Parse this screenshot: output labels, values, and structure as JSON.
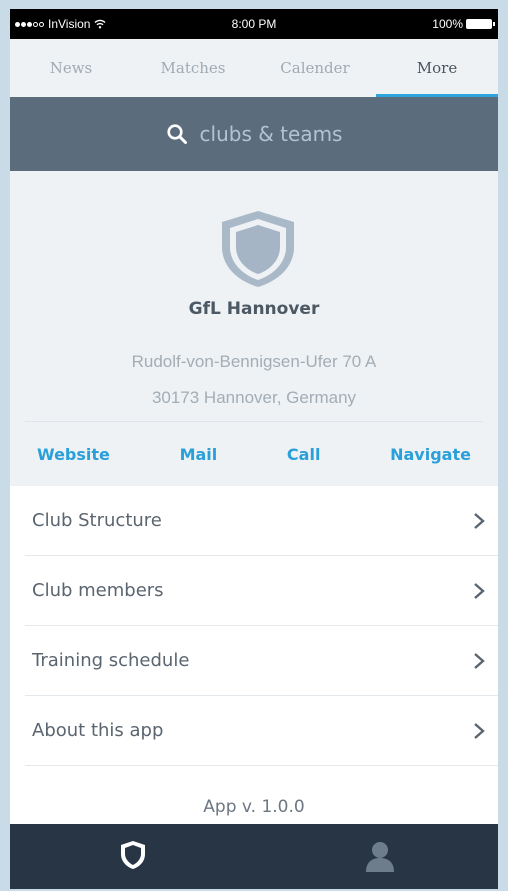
{
  "status_bar": {
    "carrier": "InVision",
    "time": "8:00 PM",
    "battery": "100%"
  },
  "tabs": [
    {
      "label": "News",
      "active": false
    },
    {
      "label": "Matches",
      "active": false
    },
    {
      "label": "Calender",
      "active": false
    },
    {
      "label": "More",
      "active": true
    }
  ],
  "search": {
    "placeholder": "clubs & teams",
    "icon": "search-icon"
  },
  "club": {
    "name": "GfL Hannover",
    "address_line1": "Rudolf-von-Bennigsen-Ufer 70 A",
    "address_line2": "30173 Hannover, Germany",
    "crest_icon": "shield-icon"
  },
  "actions": {
    "website": "Website",
    "mail": "Mail",
    "call": "Call",
    "navigate": "Navigate"
  },
  "menu": [
    {
      "label": "Club Structure"
    },
    {
      "label": "Club members"
    },
    {
      "label": "Training schedule"
    },
    {
      "label": "About this app"
    }
  ],
  "version": "App v. 1.0.0",
  "bottom_tabs": [
    {
      "icon": "shield-icon",
      "active": true
    },
    {
      "icon": "person-icon",
      "active": false
    }
  ],
  "colors": {
    "accent": "#2ea3dc",
    "search_bg": "#5b6d7d",
    "bottom_bar_bg": "#283544",
    "header_bg": "#eef2f5"
  }
}
